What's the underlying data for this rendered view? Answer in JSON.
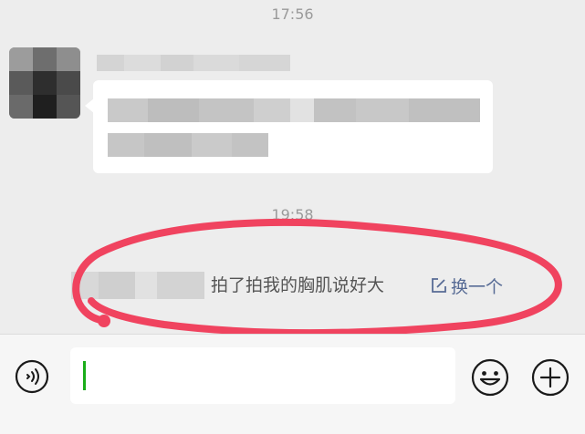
{
  "timestamps": [
    "17:56",
    "19:58"
  ],
  "pat_message": {
    "text": "拍了拍我的胸肌说好大",
    "link_label": "换一个"
  },
  "input": {
    "value": ""
  },
  "icons": {
    "voice": "voice-icon",
    "edit": "edit-icon",
    "emoji": "emoji-icon",
    "plus": "plus-icon"
  },
  "colors": {
    "background": "#ededed",
    "bubble": "#ffffff",
    "link": "#576b95",
    "caret": "#1aad19",
    "annotation_stroke": "#f0435f"
  }
}
